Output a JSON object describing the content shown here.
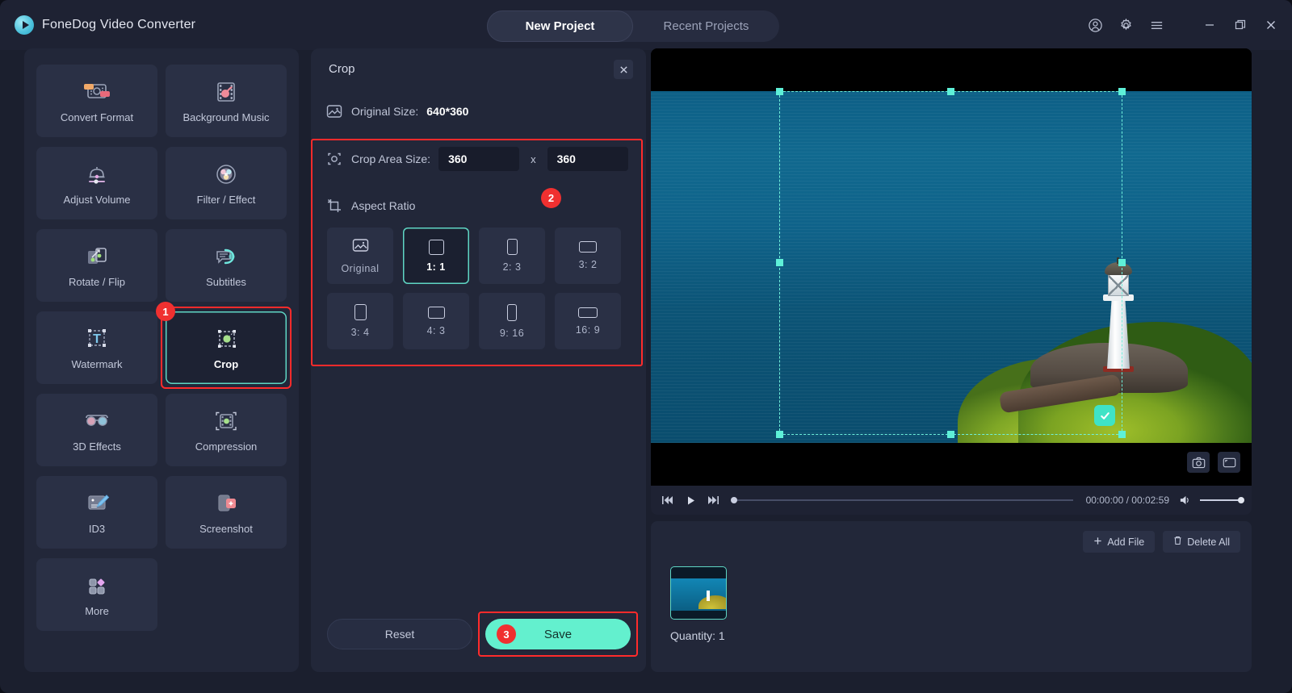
{
  "app": {
    "name": "FoneDog Video Converter",
    "logo_icon": "play-circle-icon"
  },
  "titlebar": {
    "tabs": [
      {
        "label": "New Project",
        "active": true
      },
      {
        "label": "Recent Projects",
        "active": false
      }
    ],
    "icons": [
      {
        "name": "account-icon"
      },
      {
        "name": "gear-icon"
      },
      {
        "name": "menu-icon"
      },
      {
        "name": "minimize-icon"
      },
      {
        "name": "maximize-icon"
      },
      {
        "name": "close-icon"
      }
    ]
  },
  "sidebar": {
    "tools": [
      {
        "label": "Convert Format",
        "icon": "convert-format-icon",
        "selected": false
      },
      {
        "label": "Background Music",
        "icon": "background-music-icon",
        "selected": false
      },
      {
        "label": "Adjust Volume",
        "icon": "adjust-volume-icon",
        "selected": false
      },
      {
        "label": "Filter / Effect",
        "icon": "filter-effect-icon",
        "selected": false
      },
      {
        "label": "Rotate / Flip",
        "icon": "rotate-flip-icon",
        "selected": false
      },
      {
        "label": "Subtitles",
        "icon": "subtitles-icon",
        "selected": false
      },
      {
        "label": "Watermark",
        "icon": "watermark-icon",
        "selected": false
      },
      {
        "label": "Crop",
        "icon": "crop-icon",
        "selected": true,
        "step": "1"
      },
      {
        "label": "3D Effects",
        "icon": "3d-effects-icon",
        "selected": false
      },
      {
        "label": "Compression",
        "icon": "compression-icon",
        "selected": false
      },
      {
        "label": "ID3",
        "icon": "id3-icon",
        "selected": false
      },
      {
        "label": "Screenshot",
        "icon": "screenshot-icon",
        "selected": false
      },
      {
        "label": "More",
        "icon": "more-icon",
        "selected": false
      }
    ]
  },
  "crop_panel": {
    "title": "Crop",
    "close_icon": "close-icon",
    "original_size_label": "Original Size:",
    "original_size_value": "640*360",
    "crop_area_label": "Crop Area Size:",
    "crop_width": "360",
    "crop_height": "360",
    "times_symbol": "x",
    "aspect_ratio_label": "Aspect Ratio",
    "step_badge_2": "2",
    "ratios": [
      {
        "label": "Original",
        "shape": "image",
        "selected": false
      },
      {
        "label": "1: 1",
        "shape": "square",
        "selected": true
      },
      {
        "label": "2: 3",
        "shape": "portrait-narrow",
        "selected": false
      },
      {
        "label": "3: 2",
        "shape": "landscape-wide",
        "selected": false
      },
      {
        "label": "3: 4",
        "shape": "portrait",
        "selected": false
      },
      {
        "label": "4: 3",
        "shape": "landscape",
        "selected": false
      },
      {
        "label": "9: 16",
        "shape": "portrait-tall",
        "selected": false
      },
      {
        "label": "16: 9",
        "shape": "landscape-widest",
        "selected": false
      }
    ],
    "reset_label": "Reset",
    "save_label": "Save",
    "step_badge_3": "3"
  },
  "preview": {
    "crop_confirm_icon": "check-icon",
    "snapshot_icon": "camera-icon",
    "fullscreen_icon": "expand-icon",
    "player": {
      "prev_icon": "skip-previous-icon",
      "play_icon": "play-icon",
      "next_icon": "skip-next-icon",
      "time": "00:00:00 / 00:02:59",
      "volume_icon": "volume-icon"
    }
  },
  "filelist": {
    "add_file_label": "Add File",
    "add_file_icon": "plus-icon",
    "delete_all_label": "Delete All",
    "delete_all_icon": "trash-icon",
    "quantity_label": "Quantity: 1"
  },
  "colors": {
    "accent_mint": "#63f0ce",
    "highlight_red": "#ff2b2b",
    "panel_bg": "#222739",
    "tile_bg": "#2a3045",
    "window_bg": "#1b1f2e"
  }
}
